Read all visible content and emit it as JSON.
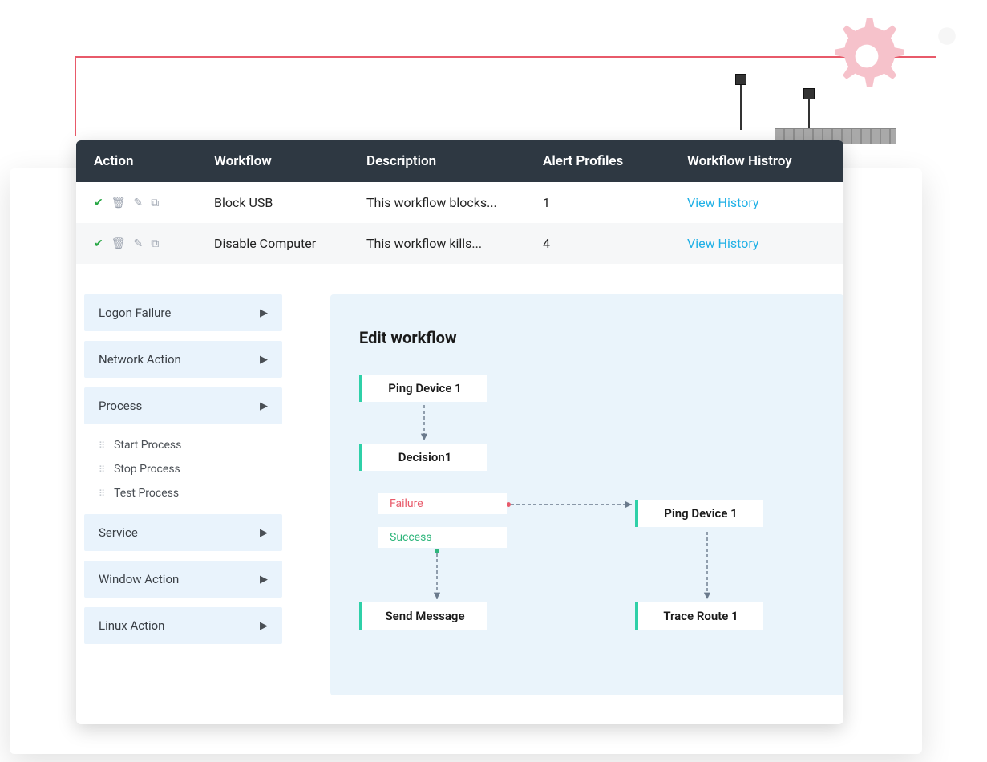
{
  "table": {
    "headers": {
      "action": "Action",
      "workflow": "Workflow",
      "description": "Description",
      "alert_profiles": "Alert Profiles",
      "workflow_history": "Workflow Histroy"
    },
    "rows": [
      {
        "workflow": "Block USB",
        "description": "This workflow blocks...",
        "alert_profiles": "1",
        "history_link": "View History"
      },
      {
        "workflow": "Disable Computer",
        "description": "This workflow kills...",
        "alert_profiles": "4",
        "history_link": "View History"
      }
    ]
  },
  "sidebar": {
    "items": [
      {
        "label": "Logon Failure"
      },
      {
        "label": "Network Action"
      },
      {
        "label": "Process",
        "children": [
          "Start Process",
          "Stop Process",
          "Test Process"
        ]
      },
      {
        "label": "Service"
      },
      {
        "label": "Window Action"
      },
      {
        "label": "Linux Action"
      }
    ]
  },
  "editor": {
    "title": "Edit workflow",
    "nodes": {
      "ping1": "Ping Device 1",
      "decision": "Decision1",
      "failure": "Failure",
      "success": "Success",
      "ping2": "Ping Device 1",
      "send": "Send Message",
      "trace": "Trace Route 1"
    }
  }
}
